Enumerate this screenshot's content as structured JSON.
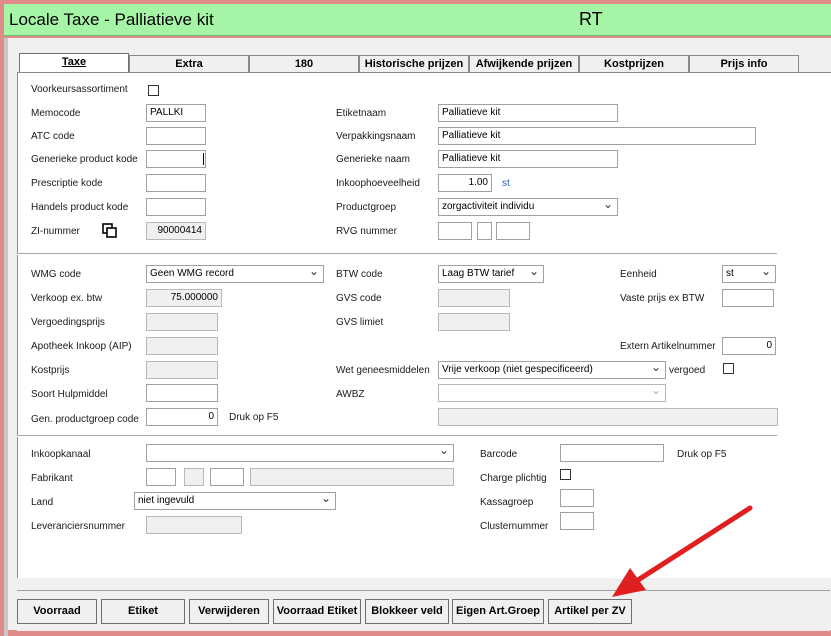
{
  "window": {
    "title": "Locale Taxe - Palliatieve kit",
    "center_code": "RT"
  },
  "tabs": [
    {
      "label": "Taxe"
    },
    {
      "label": "Extra"
    },
    {
      "label": "180"
    },
    {
      "label": "Historische prijzen"
    },
    {
      "label": "Afwijkende prijzen"
    },
    {
      "label": "Kostprijzen"
    },
    {
      "label": "Prijs info"
    }
  ],
  "form": {
    "voorkeursassortiment_label": "Voorkeursassortiment",
    "memocode_label": "Memocode",
    "memocode_value": "PALLKI",
    "atc_label": "ATC code",
    "generieke_product_kode_label": "Generieke product kode",
    "prescriptie_label": "Prescriptie kode",
    "handels_label": "Handels product kode",
    "zi_label": "ZI-nummer",
    "zi_value": "90000414",
    "etiketnaam_label": "Etiketnaam",
    "etiketnaam_value": "Palliatieve kit",
    "verpakkingsnaam_label": "Verpakkingsnaam",
    "verpakkingsnaam_value": "Palliatieve kit",
    "generieke_naam_label": "Generieke naam",
    "generieke_naam_value": "Palliatieve kit",
    "inkoophoeveelheid_label": "Inkoophoeveelheid",
    "inkoophoeveelheid_value": "1.00",
    "inkoophoeveelheid_unit": "st",
    "productgroep_label": "Productgroep",
    "productgroep_value": "zorgactiviteit individu",
    "rvg_label": "RVG nummer",
    "wmg_label": "WMG code",
    "wmg_value": "Geen WMG record",
    "verkoop_label": "Verkoop ex. btw",
    "verkoop_value": "75.000000",
    "vergoedingsprijs_label": "Vergoedingsprijs",
    "aip_label": "Apotheek Inkoop (AIP)",
    "kostprijs_label": "Kostprijs",
    "soort_label": "Soort Hulpmiddel",
    "gen_groep_label": "Gen. productgroep code",
    "gen_groep_value": "0",
    "druk_f5_1": "Druk op F5",
    "btw_label": "BTW code",
    "btw_value": "Laag BTW tarief",
    "gvs_code_label": "GVS code",
    "gvs_limiet_label": "GVS limiet",
    "wet_label": "Wet geneesmiddelen",
    "wet_value": "Vrije verkoop (niet gespecificeerd)",
    "vergoed_label": "vergoed",
    "awbz_label": "AWBZ",
    "eenheid_label": "Eenheid",
    "eenheid_value": "st",
    "vaste_prijs_label": "Vaste prijs ex BTW",
    "extern_label": "Extern Artikelnummer",
    "extern_value": "0",
    "inkoopkanaal_label": "Inkoopkanaal",
    "fabrikant_label": "Fabrikant",
    "land_label": "Land",
    "land_value": "niet ingevuld",
    "leveranciersnummer_label": "Leveranciersnummer",
    "barcode_label": "Barcode",
    "druk_f5_2": "Druk op F5",
    "charge_label": "Charge plichtig",
    "kassagroep_label": "Kassagroep",
    "clusternummer_label": "Clusternummer"
  },
  "buttons": [
    {
      "label": "Voorraad"
    },
    {
      "label": "Etiket"
    },
    {
      "label": "Verwijderen"
    },
    {
      "label": "Voorraad Etiket"
    },
    {
      "label": "Blokkeer veld"
    },
    {
      "label": "Eigen Art.Groep"
    },
    {
      "label": "Artikel per ZV"
    }
  ],
  "colors": {
    "titlebar": "#a6f5a6",
    "frame": "#e08a8a",
    "arrow": "#e02020",
    "unit_text": "#2060c0"
  },
  "icons": {
    "copy": "copy-icon",
    "arrow": "annotation-arrow"
  }
}
